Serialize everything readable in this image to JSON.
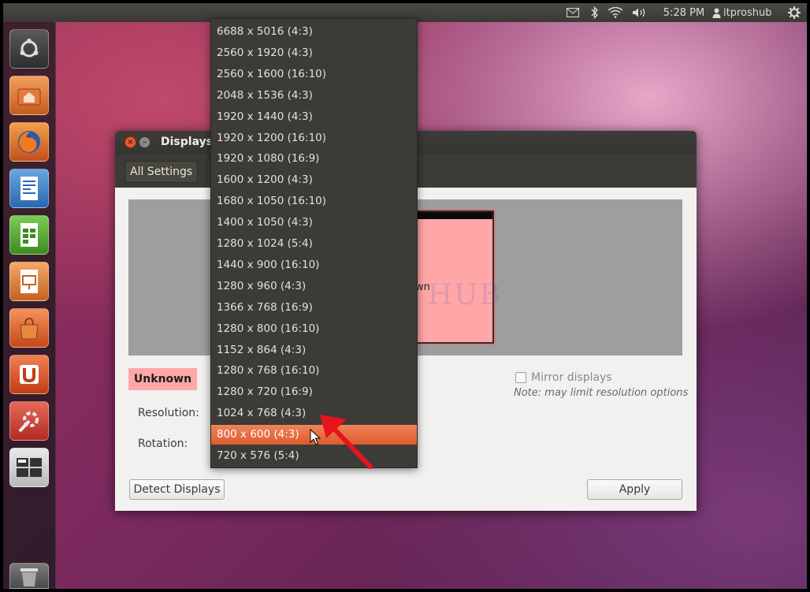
{
  "top_panel": {
    "time": "5:28 PM",
    "username": "itproshub",
    "icons": [
      "mail-icon",
      "bluetooth-icon",
      "wifi-icon",
      "volume-icon",
      "user-icon",
      "gear-icon"
    ]
  },
  "launcher": {
    "icons": [
      "ubuntu-logo-icon",
      "home-folder-icon",
      "firefox-icon",
      "writer-icon",
      "calc-icon",
      "impress-icon",
      "software-center-icon",
      "ubuntu-one-icon",
      "system-settings-icon",
      "workspace-switcher-icon",
      "trash-icon"
    ]
  },
  "window": {
    "title": "Displays",
    "all_settings_label": "All Settings",
    "monitor_label": "wn",
    "watermark": "IT Pros HUB",
    "display_name": "Unknown",
    "resolution_label": "Resolution:",
    "rotation_label": "Rotation:",
    "mirror_label": "Mirror displays",
    "note": "Note: may limit resolution options",
    "detect_label": "Detect Displays",
    "apply_label": "Apply"
  },
  "resolution_dropdown": {
    "options": [
      "6688 x 5016 (4:3)",
      "2560 x 1920 (4:3)",
      "2560 x 1600 (16:10)",
      "2048 x 1536 (4:3)",
      "1920 x 1440 (4:3)",
      "1920 x 1200 (16:10)",
      "1920 x 1080 (16:9)",
      "1600 x 1200 (4:3)",
      "1680 x 1050 (16:10)",
      "1400 x 1050 (4:3)",
      "1280 x 1024 (5:4)",
      "1440 x 900 (16:10)",
      "1280 x 960 (4:3)",
      "1366 x 768 (16:9)",
      "1280 x 800 (16:10)",
      "1152 x 864 (4:3)",
      "1280 x 768 (16:10)",
      "1280 x 720 (16:9)",
      "1024 x 768 (4:3)",
      "800 x 600 (4:3)",
      "720 x 576 (5:4)"
    ],
    "selected": "800 x 600 (4:3)"
  },
  "colors": {
    "accent_orange": "#dd5a2c",
    "highlight_pink": "#ffa7a7",
    "annotation_red": "#e8141b"
  }
}
